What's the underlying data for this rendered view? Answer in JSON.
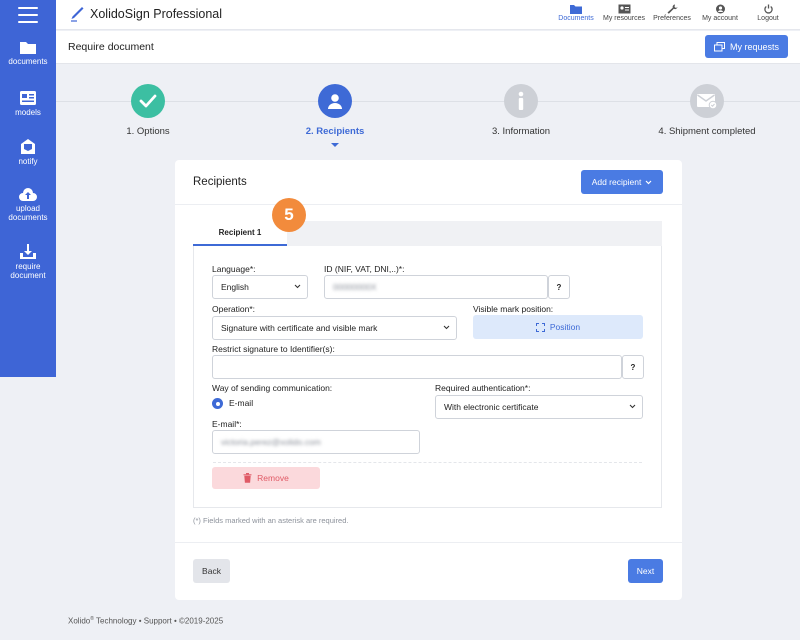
{
  "app": {
    "title": "XolidoSign Professional"
  },
  "sidebar": {
    "items": [
      {
        "label": "documents",
        "icon": "folder-icon"
      },
      {
        "label": "models",
        "icon": "models-icon"
      },
      {
        "label": "notify",
        "icon": "notify-icon"
      },
      {
        "label": "upload documents",
        "icon": "upload-icon"
      },
      {
        "label": "require document",
        "icon": "require-icon"
      }
    ]
  },
  "topnav": {
    "items": [
      {
        "label": "Documents",
        "icon": "folder-icon",
        "active": true
      },
      {
        "label": "My resources",
        "icon": "id-card-icon"
      },
      {
        "label": "Preferences",
        "icon": "wrench-icon"
      },
      {
        "label": "My account",
        "icon": "user-icon"
      },
      {
        "label": "Logout",
        "icon": "power-icon"
      }
    ]
  },
  "header": {
    "title": "Require document",
    "my_requests": "My requests"
  },
  "steps": [
    {
      "label": "1. Options",
      "state": "done"
    },
    {
      "label": "2. Recipients",
      "state": "active"
    },
    {
      "label": "3. Information",
      "state": "pending"
    },
    {
      "label": "4. Shipment completed",
      "state": "pending"
    }
  ],
  "card": {
    "title": "Recipients",
    "add_recipient": "Add recipient",
    "tab": "Recipient 1",
    "badge": "5"
  },
  "form": {
    "language_label": "Language*:",
    "language_value": "English",
    "id_label": "ID (NIF, VAT, DNI,..)*:",
    "id_value": "00000000X",
    "help": "?",
    "operation_label": "Operation*:",
    "operation_value": "Signature with certificate and visible mark",
    "visible_mark_label": "Visible mark position:",
    "position_button": "Position",
    "restrict_label": "Restrict signature to Identifier(s):",
    "restrict_value": "",
    "way_label": "Way of sending communication:",
    "way_option": "E-mail",
    "auth_label": "Required authentication*:",
    "auth_value": "With electronic certificate",
    "email_label": "E-mail*:",
    "email_value": "victoria.perez@xolido.com",
    "remove": "Remove"
  },
  "note": "(*) Fields marked with an asterisk are required.",
  "buttons": {
    "back": "Back",
    "next": "Next"
  },
  "footer": {
    "brand": "Xolido",
    "brand_mark": "®",
    "rest": " Technology  •  Support  •  ©2019-2025"
  },
  "colors": {
    "primary": "#3e65d6",
    "button": "#4a7be3",
    "success": "#3cbfa2",
    "pending": "#cdd0d6",
    "badge": "#f28b3c",
    "danger": "#e05a66"
  }
}
